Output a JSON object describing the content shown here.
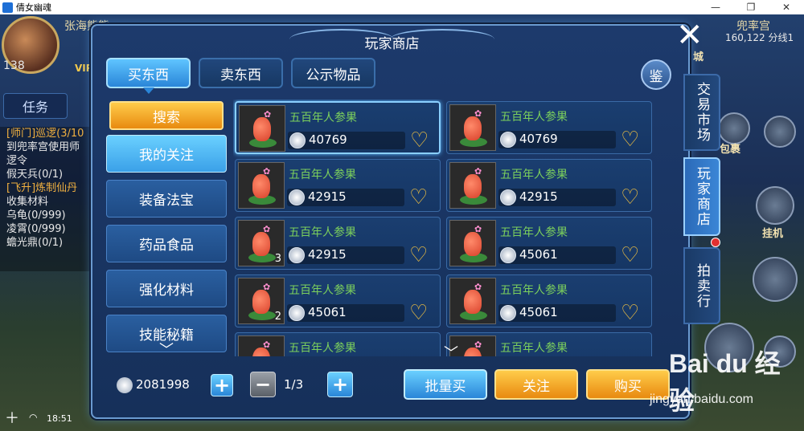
{
  "window": {
    "title": "倩女幽魂",
    "minimize": "—",
    "restore": "❐",
    "close": "✕"
  },
  "hud": {
    "player_name": "张海熊熊",
    "level": "138",
    "vip": "VIP",
    "task_tab": "任务",
    "quests": [
      {
        "text": "[师门]巡逻(3/10",
        "style": "q-title"
      },
      {
        "text": "到兜率宫使用师",
        "style": ""
      },
      {
        "text": "逻令",
        "style": ""
      },
      {
        "text": "假天兵(0/1)",
        "style": ""
      },
      {
        "text": "[飞升]炼制仙丹",
        "style": "q-title"
      },
      {
        "text": "收集材料",
        "style": ""
      },
      {
        "text": "乌龟(0/999)",
        "style": ""
      },
      {
        "text": "凌霄(0/999)",
        "style": ""
      },
      {
        "text": "蟾光鼎(0/1)",
        "style": ""
      }
    ],
    "time": "18:51",
    "map_name": "兜率宫",
    "map_coords": "160,122 分线1",
    "bag_label": "包裹",
    "auto_label": "挂机",
    "city_label": "城"
  },
  "shop": {
    "title": "玩家商店",
    "tabs": [
      "买东西",
      "卖东西",
      "公示物品"
    ],
    "appraise_label": "鉴",
    "side_tabs": [
      "交易市场",
      "玩家商店",
      "拍卖行"
    ],
    "search_label": "搜索",
    "categories": [
      "我的关注",
      "装备法宝",
      "药品食品",
      "强化材料",
      "技能秘籍"
    ],
    "items": [
      {
        "name": "五百年人参果",
        "price": "40769",
        "count": ""
      },
      {
        "name": "五百年人参果",
        "price": "40769",
        "count": ""
      },
      {
        "name": "五百年人参果",
        "price": "42915",
        "count": ""
      },
      {
        "name": "五百年人参果",
        "price": "42915",
        "count": ""
      },
      {
        "name": "五百年人参果",
        "price": "42915",
        "count": "3"
      },
      {
        "name": "五百年人参果",
        "price": "45061",
        "count": ""
      },
      {
        "name": "五百年人参果",
        "price": "45061",
        "count": "2"
      },
      {
        "name": "五百年人参果",
        "price": "45061",
        "count": ""
      },
      {
        "name": "五百年人参果",
        "price": "",
        "count": ""
      },
      {
        "name": "五百年人参果",
        "price": "",
        "count": ""
      }
    ],
    "balance": "2081998",
    "page": "1/3",
    "bulk_buy_label": "批量买",
    "follow_label": "关注",
    "buy_label": "购买"
  },
  "watermark": {
    "logo": "Bai du 经验",
    "url": "jingyan.baidu.com"
  },
  "colors": {
    "accent": "#2a86d8",
    "gold": "#e88a10",
    "item_name": "#7cd05c"
  }
}
